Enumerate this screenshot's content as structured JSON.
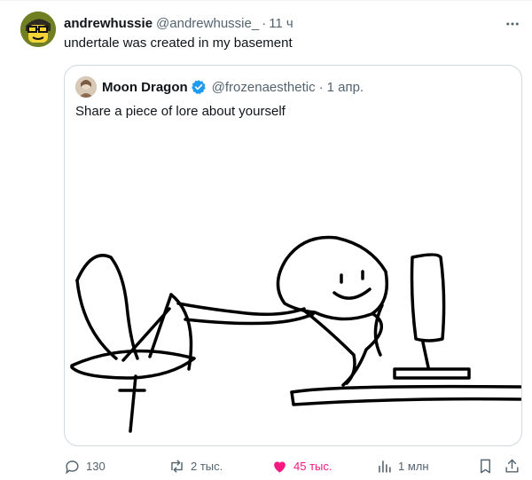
{
  "tweet": {
    "author_name": "andrewhussie",
    "author_handle": "@andrewhussie_",
    "separator": "·",
    "time": "11 ч",
    "text": "undertale was created in my basement"
  },
  "quoted": {
    "author_name": "Moon Dragon",
    "author_handle": "@frozenaesthetic",
    "separator": "·",
    "time": "1 апр.",
    "text": "Share a piece of lore about yourself"
  },
  "actions": {
    "replies": "130",
    "reposts": "2 тыс.",
    "likes": "45 тыс.",
    "views": "1 млн"
  },
  "icons": {
    "more": "more-horizontal-icon",
    "verified": "verified-badge-icon",
    "reply": "reply-icon",
    "repost": "repost-icon",
    "like": "heart-icon",
    "views": "views-chart-icon",
    "bookmark": "bookmark-icon",
    "share": "share-icon"
  },
  "colors": {
    "like_active": "#f91880",
    "verified_blue": "#1d9bf0",
    "secondary_text": "#536471"
  }
}
